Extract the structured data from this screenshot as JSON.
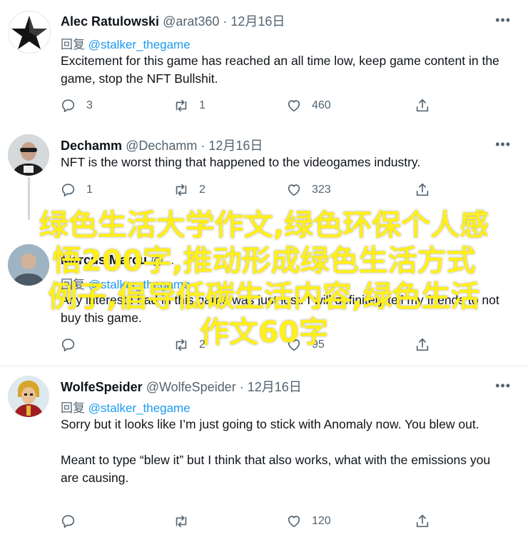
{
  "tweets": [
    {
      "name": "Alec Ratulowski",
      "meta": "@arat360 · 12月16日",
      "reply_prefix": "回复",
      "reply_handle": "@stalker_thegame",
      "text": "Excitement for this game has reached an all time low, keep game content in the game, stop the NFT Bullshit.",
      "replies": "3",
      "retweets": "1",
      "likes": "460"
    },
    {
      "name": "Dechamm",
      "meta": "@Dechamm · 12月16日",
      "text": "NFT is the worst thing that happened to the videogames industry.",
      "replies": "1",
      "retweets": "2",
      "likes": "323"
    },
    {
      "name": "Marcus Marcu",
      "meta": "@...",
      "reply_prefix": "回复",
      "reply_handle": "@stalker_thegame",
      "text": "Any interest I had in this game was just lost. I will definitely tell my friends to not buy this game.",
      "replies": "",
      "retweets": "2",
      "likes": "95"
    },
    {
      "name": "WolfeSpeider",
      "meta": "@WolfeSpeider · 12月16日",
      "reply_prefix": "回复",
      "reply_handle": "@stalker_thegame",
      "text": "Sorry but it looks like I’m just going to stick with Anomaly now. You blew out.\n\nMeant to type “blew it” but I think that also works, what with the emissions you are causing.",
      "replies": "",
      "retweets": "",
      "likes": "120"
    }
  ],
  "more_glyph": "•••",
  "overlay_lines": [
    "绿色生活大学作文,绿色环保个人感",
    "悟200字,推动形成绿色生活方式",
    "例子,倡导低碳生活内容,绿色生活",
    "作文60字"
  ],
  "colors": {
    "accent": "#1d9bf0",
    "overlay": "#ffef1a",
    "muted": "#536471"
  }
}
